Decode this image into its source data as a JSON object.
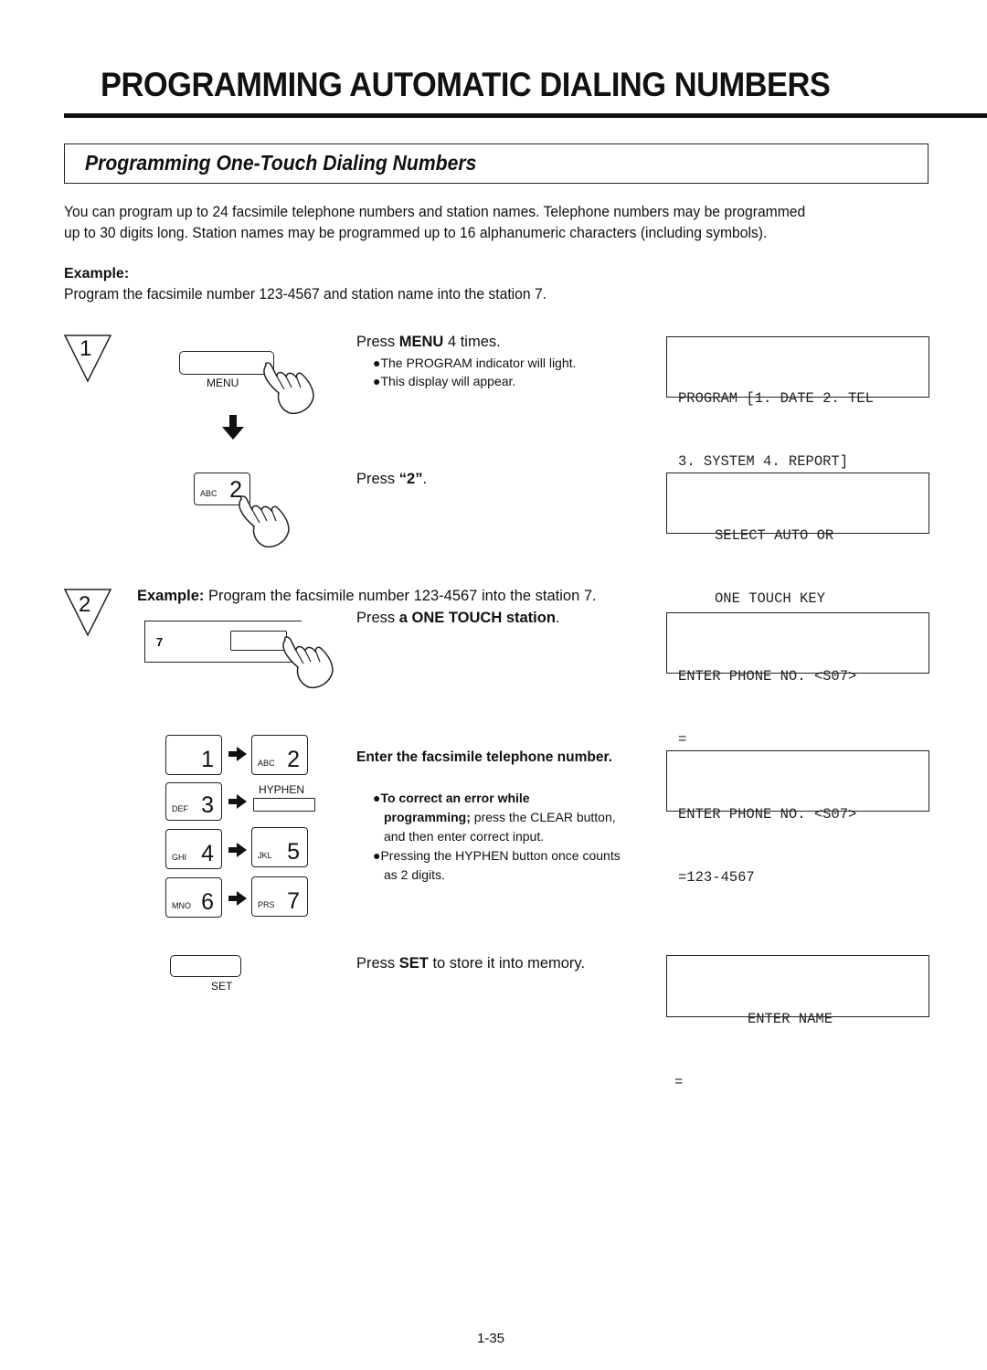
{
  "page": {
    "title": "PROGRAMMING AUTOMATIC DIALING NUMBERS",
    "section_title": "Programming One-Touch Dialing Numbers",
    "intro_line1": "You can program up to 24 facsimile telephone numbers and station names. Telephone numbers may be programmed",
    "intro_line2": "up to 30 digits long. Station names may be programmed up to 16 alphanumeric characters (including symbols).",
    "example_label": "Example:",
    "example_text": "Program the facsimile number 123-4567 and station name into the station 7.",
    "page_number": "1-35"
  },
  "step1": {
    "number": "1",
    "menu_key_label": "MENU",
    "press_prefix": "Press ",
    "press_key": "MENU",
    "press_suffix": " 4 times.",
    "bullets": [
      "●The PROGRAM indicator will light.",
      "●This display will appear."
    ],
    "display": {
      "line1": "PROGRAM [1. DATE 2. TEL",
      "line2": "3. SYSTEM 4. REPORT]"
    },
    "key2": {
      "letters": "ABC",
      "digit": "2"
    },
    "press2_prefix": "Press ",
    "press2_key": "“2”",
    "press2_suffix": ".",
    "display2": {
      "line1": "SELECT AUTO OR",
      "line2": "ONE TOUCH KEY"
    }
  },
  "step2": {
    "number": "2",
    "example_label": "Example:",
    "example_text": "  Program the facsimile number 123-4567 into the station 7.",
    "station_label": "7",
    "press_prefix": "Press ",
    "press_key": "a ONE TOUCH station",
    "press_suffix": ".",
    "display": {
      "line1": "ENTER PHONE NO. <S07>",
      "line2": "="
    },
    "keys": [
      {
        "letters": "",
        "digit": "1"
      },
      {
        "letters": "ABC",
        "digit": "2"
      },
      {
        "letters": "DEF",
        "digit": "3"
      },
      {
        "letters": "HYPHEN",
        "digit": ""
      },
      {
        "letters": "GHI",
        "digit": "4"
      },
      {
        "letters": "JKL",
        "digit": "5"
      },
      {
        "letters": "MNO",
        "digit": "6"
      },
      {
        "letters": "PRS",
        "digit": "7"
      }
    ],
    "enter_instruction": "Enter the facsimile telephone number.",
    "note1_bold": "●To correct an error while",
    "note1_bold2": "programming;",
    "note1_rest": " press the CLEAR button,",
    "note1_line3": "and then enter correct input.",
    "note2_line1": "●Pressing the HYPHEN button once counts",
    "note2_line2": "as 2 digits.",
    "display2": {
      "line1": "ENTER PHONE NO. <S07>",
      "line2": "=123-4567"
    },
    "set_key_label": "SET",
    "set_prefix": "Press ",
    "set_key": "SET",
    "set_suffix": " to store it into memory.",
    "display3": {
      "line1": "ENTER NAME",
      "line2": "="
    }
  }
}
